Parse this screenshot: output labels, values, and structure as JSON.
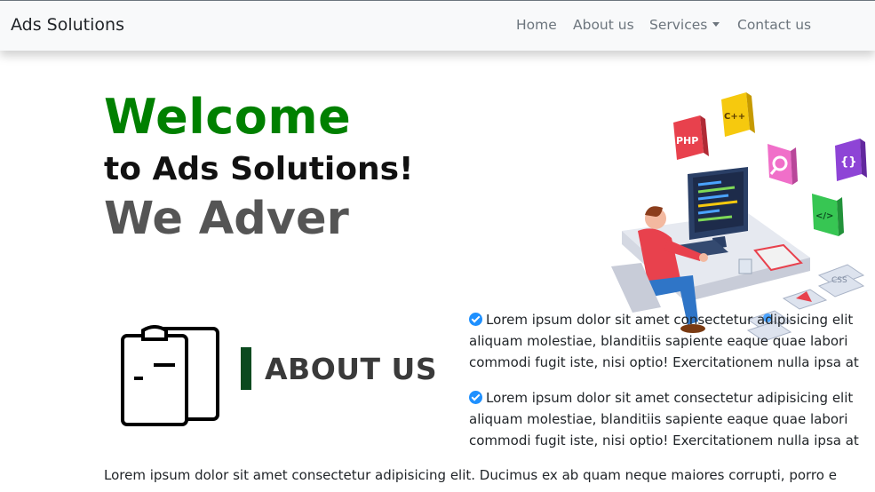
{
  "navbar": {
    "brand": "Ads Solutions",
    "links": [
      {
        "label": "Home"
      },
      {
        "label": "About us"
      },
      {
        "label": "Services",
        "dropdown": true
      },
      {
        "label": "Contact us"
      }
    ]
  },
  "hero": {
    "welcome": "Welcome",
    "subtitle": "to Ads Solutions!",
    "typed_text": "We Adver",
    "illustration_icons": [
      "PHP",
      "C++",
      "</>",
      "{}",
      "CSS"
    ]
  },
  "about": {
    "title": "ABOUT US",
    "paragraphs": [
      [
        "Lorem ipsum dolor sit amet consectetur adipisicing elit",
        "aliquam molestiae, blanditiis sapiente eaque quae labori",
        "commodi fugit iste, nisi optio! Exercitationem nulla ipsa at"
      ],
      [
        "Lorem ipsum dolor sit amet consectetur adipisicing elit",
        "aliquam molestiae, blanditiis sapiente eaque quae labori",
        "commodi fugit iste, nisi optio! Exercitationem nulla ipsa at"
      ]
    ],
    "bottom_text": "Lorem ipsum dolor sit amet consectetur adipisicing elit. Ducimus ex ab quam neque maiores corrupti, porro e"
  },
  "colors": {
    "welcome": "#008000",
    "accent_bar": "#0b4a1f",
    "check": "#1e90ff",
    "navbar_bg": "#f8f9fa"
  }
}
